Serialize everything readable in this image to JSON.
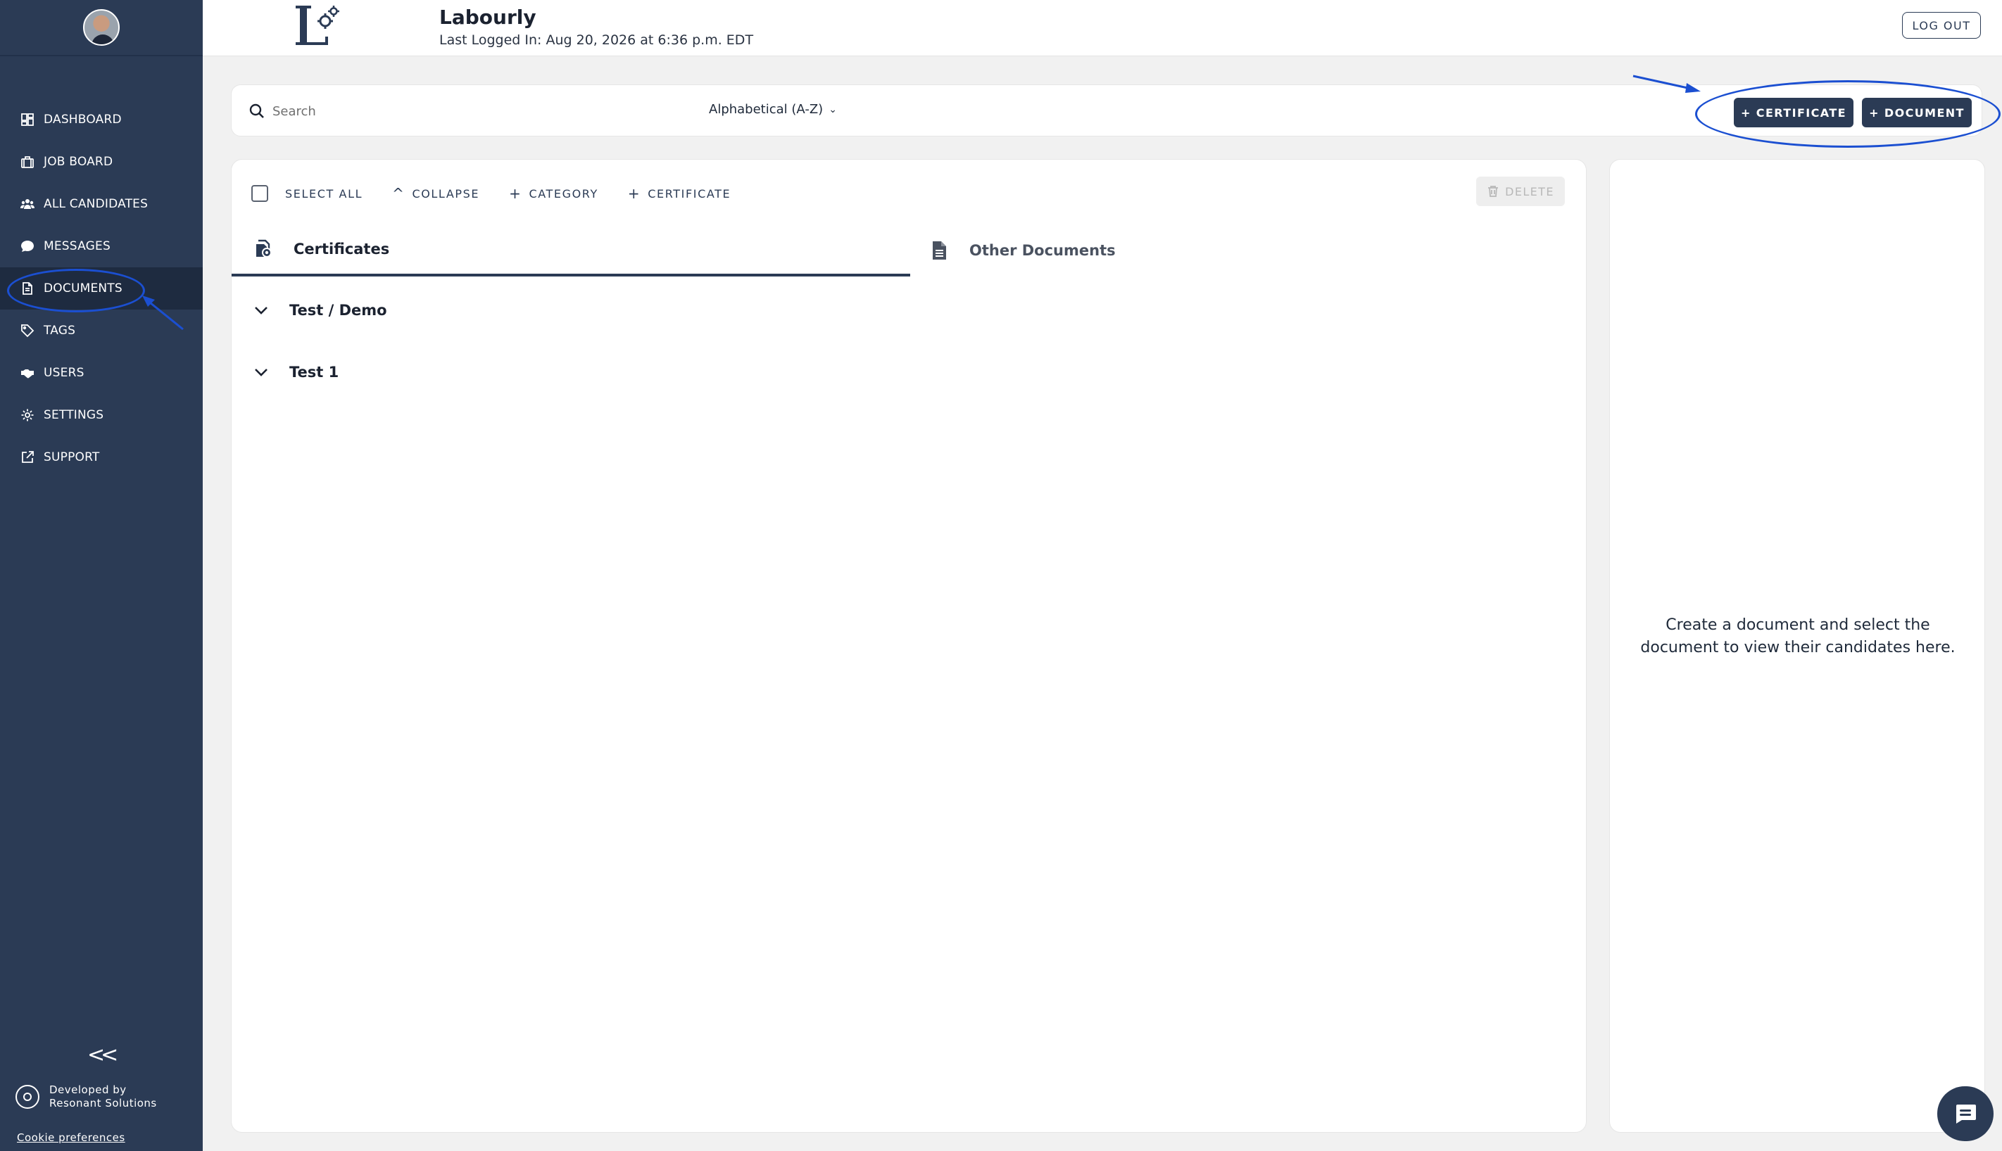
{
  "header": {
    "app_name": "Labourly",
    "last_login": "Last Logged In: Aug 20, 2026 at 6:36 p.m. EDT",
    "logout_label": "LOG OUT"
  },
  "sidebar": {
    "items": [
      {
        "label": "DASHBOARD",
        "icon": "dashboard-icon"
      },
      {
        "label": "JOB BOARD",
        "icon": "briefcase-icon"
      },
      {
        "label": "ALL CANDIDATES",
        "icon": "people-icon"
      },
      {
        "label": "MESSAGES",
        "icon": "chat-icon"
      },
      {
        "label": "DOCUMENTS",
        "icon": "document-icon"
      },
      {
        "label": "TAGS",
        "icon": "tag-icon"
      },
      {
        "label": "USERS",
        "icon": "handshake-icon"
      },
      {
        "label": "SETTINGS",
        "icon": "gear-icon"
      },
      {
        "label": "SUPPORT",
        "icon": "external-link-icon"
      }
    ],
    "active": "DOCUMENTS",
    "collapse_glyph": "<<",
    "developer_line1": "Developed by",
    "developer_line2": "Resonant Solutions",
    "cookie_label": "Cookie preferences"
  },
  "searchbar": {
    "placeholder": "Search",
    "sort_label": "Alphabetical (A-Z)",
    "add_certificate_label": "+ CERTIFICATE",
    "add_document_label": "+ DOCUMENT"
  },
  "toolbar": {
    "select_all": "SELECT ALL",
    "collapse": "COLLAPSE",
    "category": "CATEGORY",
    "certificate": "CERTIFICATE",
    "delete": "DELETE"
  },
  "tabs": {
    "certificates": "Certificates",
    "other_documents": "Other Documents"
  },
  "categories": [
    "Test / Demo",
    "Test 1"
  ],
  "detail": {
    "empty_message": "Create a document and select the document to view their candidates here."
  },
  "colors": {
    "sidebar": "#2b3b55",
    "accent": "#2b3b55",
    "annotation": "#1b4fd1"
  }
}
